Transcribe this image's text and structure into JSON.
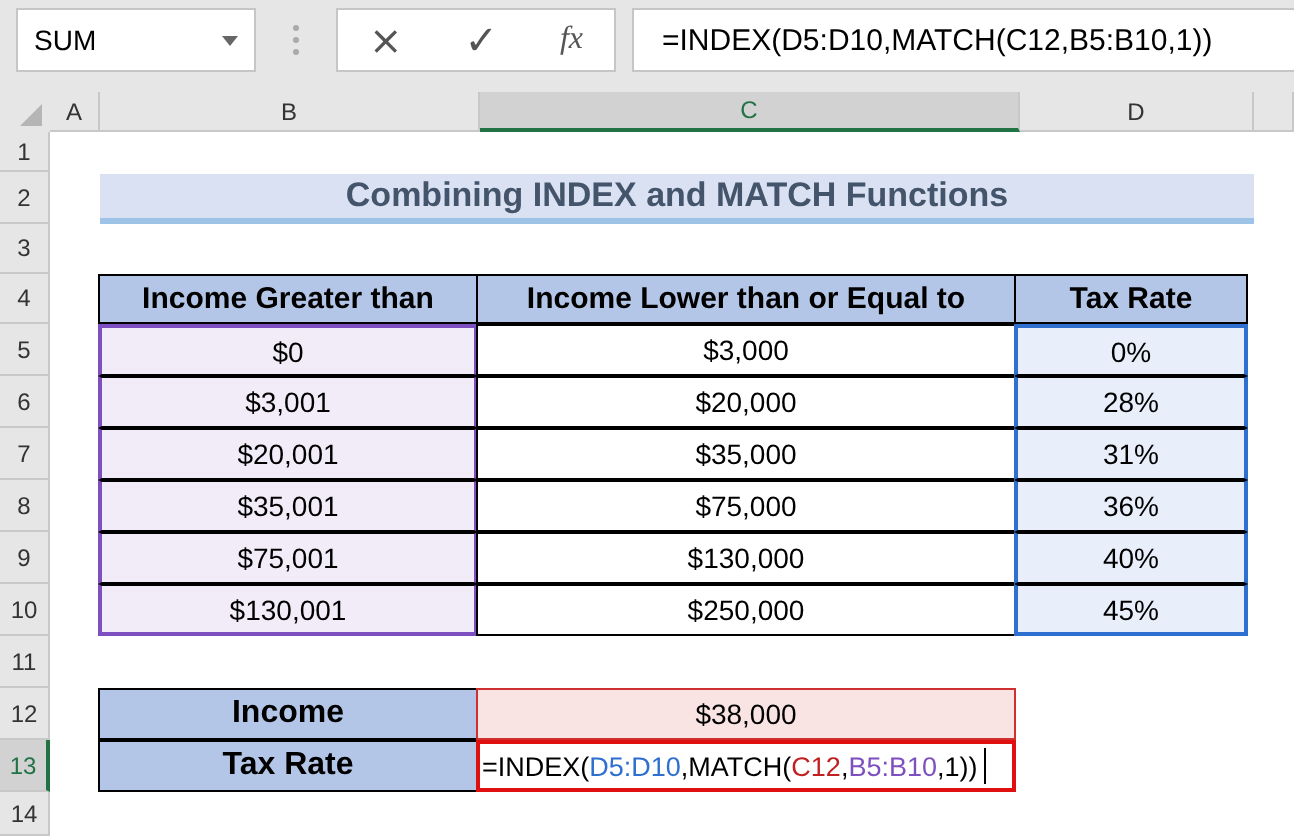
{
  "formula_bar": {
    "name_box": "SUM",
    "cancel": "×",
    "enter": "✓",
    "function": "fx",
    "formula": "=INDEX(D5:D10,MATCH(C12,B5:B10,1))"
  },
  "column_headers": [
    {
      "label": "A",
      "selected": false
    },
    {
      "label": "B",
      "selected": false
    },
    {
      "label": "C",
      "selected": true
    },
    {
      "label": "D",
      "selected": false
    }
  ],
  "row_headers": [
    {
      "label": "1",
      "selected": false
    },
    {
      "label": "2",
      "selected": false
    },
    {
      "label": "3",
      "selected": false
    },
    {
      "label": "4",
      "selected": false
    },
    {
      "label": "5",
      "selected": false
    },
    {
      "label": "6",
      "selected": false
    },
    {
      "label": "7",
      "selected": false
    },
    {
      "label": "8",
      "selected": false
    },
    {
      "label": "9",
      "selected": false
    },
    {
      "label": "10",
      "selected": false
    },
    {
      "label": "11",
      "selected": false
    },
    {
      "label": "12",
      "selected": false
    },
    {
      "label": "13",
      "selected": true
    },
    {
      "label": "14",
      "selected": false
    }
  ],
  "title": "Combining INDEX and MATCH Functions",
  "table": {
    "columns": [
      {
        "label": "Income Greater than",
        "color": "#7e4fc0"
      },
      {
        "label": "Income Lower than or Equal to"
      },
      {
        "label": "Tax Rate",
        "color": "#2e6fd0"
      }
    ],
    "rows": [
      [
        "$0",
        "$3,000",
        "0%"
      ],
      [
        "$3,001",
        "$20,000",
        "28%"
      ],
      [
        "$20,001",
        "$35,000",
        "31%"
      ],
      [
        "$35,001",
        "$75,000",
        "36%"
      ],
      [
        "$75,001",
        "$130,000",
        "40%"
      ],
      [
        "$130,001",
        "$250,000",
        "45%"
      ]
    ]
  },
  "summary": [
    {
      "label": "Income",
      "value": "$38,000",
      "color": "#d03030",
      "editing": false
    },
    {
      "label": "Tax Rate",
      "editing": true,
      "segments": [
        {
          "text": "=INDEX(",
          "color": "#000000"
        },
        {
          "text": "D5:D10",
          "color": "#2e6fd0"
        },
        {
          "text": ",MATCH(",
          "color": "#000000"
        },
        {
          "text": "C12",
          "color": "#c02020"
        },
        {
          "text": ",",
          "color": "#000000"
        },
        {
          "text": "B5:B10",
          "color": "#7e4fc0"
        },
        {
          "text": ",1))",
          "color": "#000000"
        }
      ]
    }
  ]
}
